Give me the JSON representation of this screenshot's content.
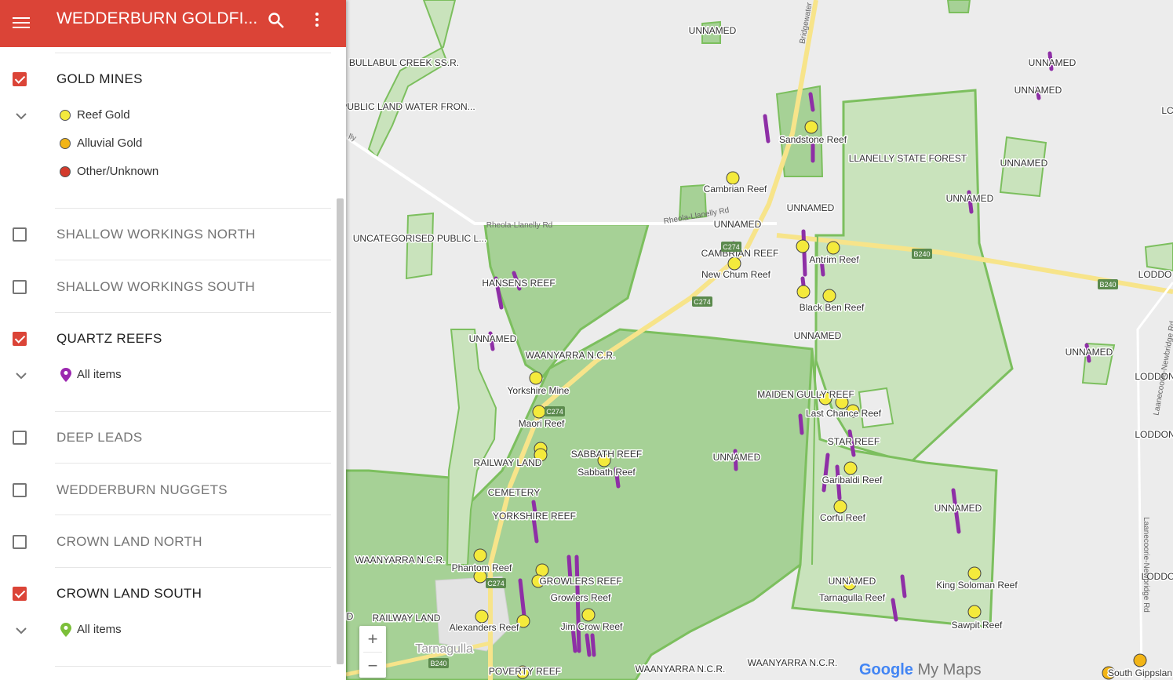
{
  "header": {
    "title": "WEDDERBURN GOLDFI...",
    "color": "#db4437"
  },
  "layers": [
    {
      "name": "GOLD MINES",
      "checked": true,
      "legend": [
        {
          "label": "Reef Gold",
          "color": "#f4ea3c"
        },
        {
          "label": "Alluvial Gold",
          "color": "#f2b517"
        },
        {
          "label": "Other/Unknown",
          "color": "#d33a2c"
        }
      ]
    },
    {
      "name": "SHALLOW WORKINGS NORTH",
      "checked": false
    },
    {
      "name": "SHALLOW WORKINGS SOUTH",
      "checked": false
    },
    {
      "name": "QUARTZ REEFS",
      "checked": true,
      "legend": [
        {
          "label": "All items",
          "icon": "purple-pin-icon"
        }
      ]
    },
    {
      "name": "DEEP LEADS",
      "checked": false
    },
    {
      "name": "WEDDERBURN NUGGETS",
      "checked": false
    },
    {
      "name": "CROWN LAND NORTH",
      "checked": false
    },
    {
      "name": "CROWN LAND SOUTH",
      "checked": true,
      "legend": [
        {
          "label": "All items",
          "icon": "green-pin-icon"
        }
      ]
    }
  ],
  "zoom": {
    "in": "+",
    "out": "−"
  },
  "brand": {
    "google": "Google",
    "product": "My Maps"
  },
  "map": {
    "labels": [
      "UNNAMED",
      "BULLABUL CREEK SS.R.",
      "PUBLIC LAND WATER FRON...",
      "UNCATEGORISED PUBLIC L...",
      "HANSENS REEF",
      "UNNAMED",
      "WAANYARRA N.C.R.",
      "Yorkshire Mine",
      "Maori Reef",
      "RAILWAY LAND",
      "CEMETERY",
      "YORKSHIRE REEF",
      "WAANYARRA N.C.R.",
      "Phantom Reef",
      "RAILWAY LAND",
      "Alexanders Reef",
      "Tarnagulla",
      "POVERTY REEF",
      "SABBATH REEF",
      "Sabbath Reef",
      "GROWLERS REEF",
      "Growlers Reef",
      "Jim Crow Reef",
      "WAANYARRA N.C.R.",
      "WAANYARRA N.C.R.",
      "UNNAMED",
      "Cambrian Reef",
      "UNNAMED",
      "CAMBRIAN REEF",
      "New Chum Reef",
      "Sandstone Reef",
      "UNNAMED",
      "Antrim Reef",
      "Black Ben Reef",
      "UNNAMED",
      "LLANELLY STATE FOREST",
      "UNNAMED",
      "UNNAMED",
      "UNNAMED",
      "UNNAMED",
      "UNNAMED",
      "MAIDEN GULLY REEF",
      "Last Chance Reef",
      "STAR REEF",
      "Garibaldi Reef",
      "Corfu Reef",
      "UNNAMED",
      "UNNAMED",
      "Tarnagulla Reef",
      "King Soloman Reef",
      "Sawpit Reef",
      "LODDO",
      "LODDON",
      "LODDON",
      "LODDO",
      "LC",
      "South Gippslan",
      "D"
    ],
    "roads": [
      "Rheola-Llanelly Rd",
      "Rheola-Llanelly Rd",
      "Bridgewater",
      "Laanecoorie-Newbridge Rd",
      "Laanecoorie-Newbridge Rd",
      "lly"
    ],
    "badges": [
      "C274",
      "C274",
      "C274",
      "C274",
      "B240",
      "B240",
      "B240"
    ]
  }
}
